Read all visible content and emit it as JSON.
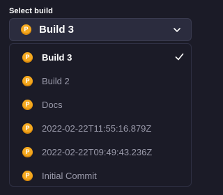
{
  "field": {
    "label": "Select build",
    "selected": "Build 3"
  },
  "coin_letter": "P",
  "options": [
    {
      "label": "Build 3",
      "selected": true
    },
    {
      "label": "Build 2",
      "selected": false
    },
    {
      "label": "Docs",
      "selected": false
    },
    {
      "label": "2022-02-22T11:55:16.879Z",
      "selected": false
    },
    {
      "label": "2022-02-22T09:49:43.236Z",
      "selected": false
    },
    {
      "label": "Initial Commit",
      "selected": false
    }
  ],
  "icons": {
    "coin": "p-coin-icon",
    "dropdown": "chevron-down-icon",
    "selected": "checkmark-icon"
  },
  "colors": {
    "background": "#1b1b27",
    "field_background": "#2b2c3e",
    "coin": "#f4a81f",
    "active_text": "#ffffff",
    "muted_text": "#9b9bab"
  }
}
